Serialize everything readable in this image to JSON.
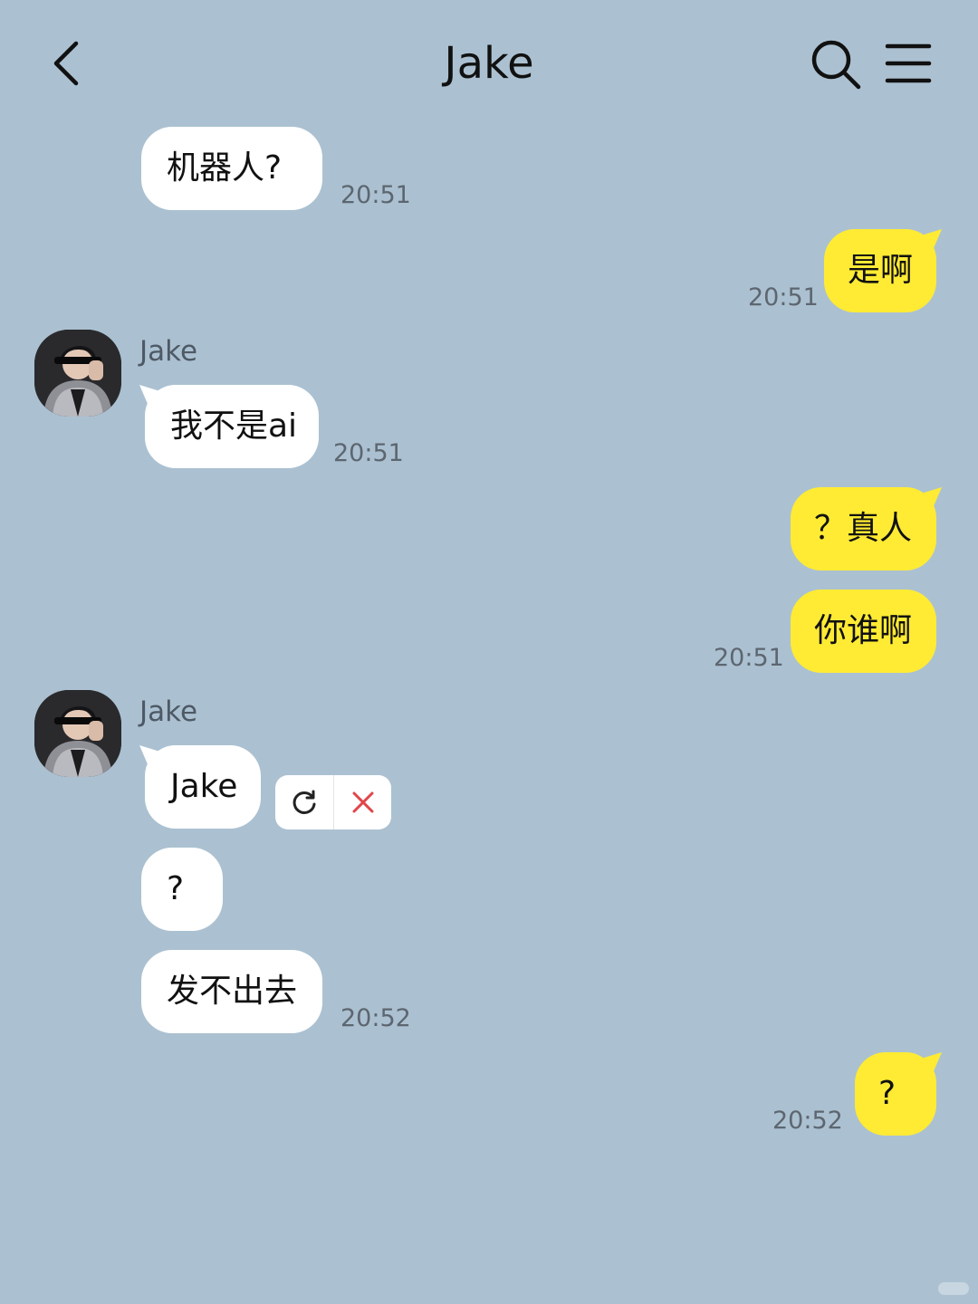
{
  "header": {
    "title": "Jake",
    "back_icon": "chevron-left-icon",
    "search_icon": "search-icon",
    "menu_icon": "hamburger-menu-icon"
  },
  "colors": {
    "background": "#abc1d1",
    "incoming_bubble": "#ffffff",
    "outgoing_bubble": "#ffeb34",
    "timestamp": "#5d6670",
    "cancel_icon": "#e0464a"
  },
  "messages": [
    {
      "direction": "incoming",
      "text": "机器人?",
      "time": "20:51"
    },
    {
      "direction": "outgoing",
      "text": "是啊",
      "time": "20:51"
    },
    {
      "direction": "incoming",
      "sender": "Jake",
      "text": "我不是ai",
      "time": "20:51"
    },
    {
      "direction": "outgoing",
      "text": "？真人",
      "time": ""
    },
    {
      "direction": "outgoing",
      "text": "你谁啊",
      "time": "20:51"
    },
    {
      "direction": "incoming",
      "sender": "Jake",
      "text": "Jake",
      "time": "",
      "status": "failed"
    },
    {
      "direction": "incoming",
      "text": "?",
      "time": ""
    },
    {
      "direction": "incoming",
      "text": "发不出去",
      "time": "20:52"
    },
    {
      "direction": "outgoing",
      "text": "?",
      "time": "20:52"
    }
  ],
  "failed_actions": {
    "retry_icon": "retry-icon",
    "cancel_icon": "close-icon"
  }
}
